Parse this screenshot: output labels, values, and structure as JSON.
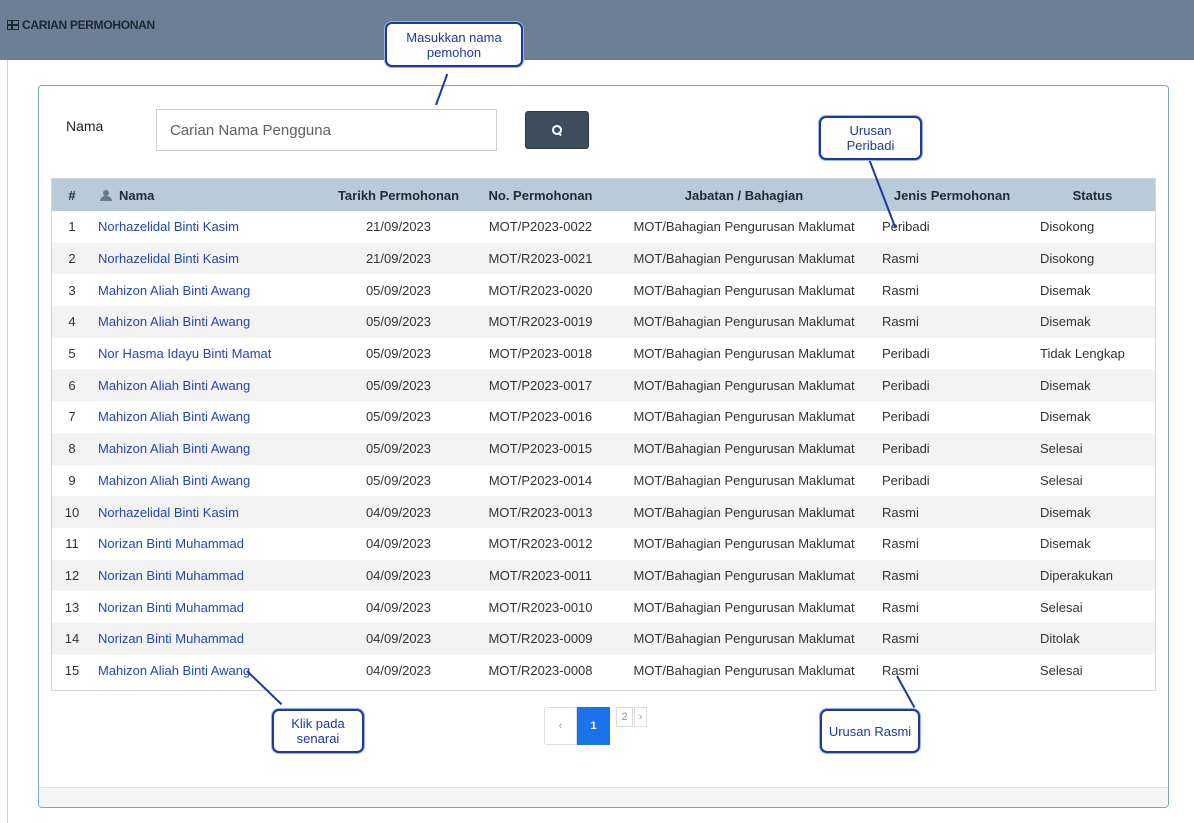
{
  "header": {
    "title": "CARIAN PERMOHONAN",
    "icon": "table-icon"
  },
  "search": {
    "label": "Nama",
    "placeholder": "Carian Nama Pengguna"
  },
  "table": {
    "headers": [
      "#",
      "Nama",
      "Tarikh Permohonan",
      "No. Permohonan",
      "Jabatan / Bahagian",
      "Jenis Permohonan",
      "Status"
    ],
    "rows": [
      {
        "n": "1",
        "nama": "Norhazelidal Binti Kasim",
        "tarikh": "21/09/2023",
        "no": "MOT/P2023-0022",
        "jabatan": "MOT/Bahagian Pengurusan Maklumat",
        "jenis": "Peribadi",
        "status": "Disokong"
      },
      {
        "n": "2",
        "nama": "Norhazelidal Binti Kasim",
        "tarikh": "21/09/2023",
        "no": "MOT/R2023-0021",
        "jabatan": "MOT/Bahagian Pengurusan Maklumat",
        "jenis": "Rasmi",
        "status": "Disokong"
      },
      {
        "n": "3",
        "nama": "Mahizon Aliah Binti Awang",
        "tarikh": "05/09/2023",
        "no": "MOT/R2023-0020",
        "jabatan": "MOT/Bahagian Pengurusan Maklumat",
        "jenis": "Rasmi",
        "status": "Disemak"
      },
      {
        "n": "4",
        "nama": "Mahizon Aliah Binti Awang",
        "tarikh": "05/09/2023",
        "no": "MOT/R2023-0019",
        "jabatan": "MOT/Bahagian Pengurusan Maklumat",
        "jenis": "Rasmi",
        "status": "Disemak"
      },
      {
        "n": "5",
        "nama": "Nor Hasma Idayu Binti Mamat",
        "tarikh": "05/09/2023",
        "no": "MOT/P2023-0018",
        "jabatan": "MOT/Bahagian Pengurusan Maklumat",
        "jenis": "Peribadi",
        "status": "Tidak Lengkap"
      },
      {
        "n": "6",
        "nama": "Mahizon Aliah Binti Awang",
        "tarikh": "05/09/2023",
        "no": "MOT/P2023-0017",
        "jabatan": "MOT/Bahagian Pengurusan Maklumat",
        "jenis": "Peribadi",
        "status": "Disemak"
      },
      {
        "n": "7",
        "nama": "Mahizon Aliah Binti Awang",
        "tarikh": "05/09/2023",
        "no": "MOT/P2023-0016",
        "jabatan": "MOT/Bahagian Pengurusan Maklumat",
        "jenis": "Peribadi",
        "status": "Disemak"
      },
      {
        "n": "8",
        "nama": "Mahizon Aliah Binti Awang",
        "tarikh": "05/09/2023",
        "no": "MOT/P2023-0015",
        "jabatan": "MOT/Bahagian Pengurusan Maklumat",
        "jenis": "Peribadi",
        "status": "Selesai"
      },
      {
        "n": "9",
        "nama": "Mahizon Aliah Binti Awang",
        "tarikh": "05/09/2023",
        "no": "MOT/P2023-0014",
        "jabatan": "MOT/Bahagian Pengurusan Maklumat",
        "jenis": "Peribadi",
        "status": "Selesai"
      },
      {
        "n": "10",
        "nama": "Norhazelidal Binti Kasim",
        "tarikh": "04/09/2023",
        "no": "MOT/R2023-0013",
        "jabatan": "MOT/Bahagian Pengurusan Maklumat",
        "jenis": "Rasmi",
        "status": "Disemak"
      },
      {
        "n": "11",
        "nama": "Norizan Binti Muhammad",
        "tarikh": "04/09/2023",
        "no": "MOT/R2023-0012",
        "jabatan": "MOT/Bahagian Pengurusan Maklumat",
        "jenis": "Rasmi",
        "status": "Disemak"
      },
      {
        "n": "12",
        "nama": "Norizan Binti Muhammad",
        "tarikh": "04/09/2023",
        "no": "MOT/R2023-0011",
        "jabatan": "MOT/Bahagian Pengurusan Maklumat",
        "jenis": "Rasmi",
        "status": "Diperakukan"
      },
      {
        "n": "13",
        "nama": "Norizan Binti Muhammad",
        "tarikh": "04/09/2023",
        "no": "MOT/R2023-0010",
        "jabatan": "MOT/Bahagian Pengurusan Maklumat",
        "jenis": "Rasmi",
        "status": "Selesai"
      },
      {
        "n": "14",
        "nama": "Norizan Binti Muhammad",
        "tarikh": "04/09/2023",
        "no": "MOT/R2023-0009",
        "jabatan": "MOT/Bahagian Pengurusan Maklumat",
        "jenis": "Rasmi",
        "status": "Ditolak"
      },
      {
        "n": "15",
        "nama": "Mahizon Aliah Binti Awang",
        "tarikh": "04/09/2023",
        "no": "MOT/R2023-0008",
        "jabatan": "MOT/Bahagian Pengurusan Maklumat",
        "jenis": "Rasmi",
        "status": "Selesai"
      }
    ]
  },
  "pagination": {
    "prev": "‹",
    "current": "1",
    "page2": "2",
    "next": "›"
  },
  "callouts": {
    "search": "Masukkan nama pemohon",
    "peribadi": "Urusan Peribadi",
    "rasmi": "Urusan Rasmi",
    "senarai": "Klik pada senarai"
  },
  "colors": {
    "topbar": "#6d7f94",
    "table_header": "#b9cad9",
    "link": "#2246b8",
    "active_page": "#1a73e8",
    "callout_border": "#1d3a9a"
  }
}
